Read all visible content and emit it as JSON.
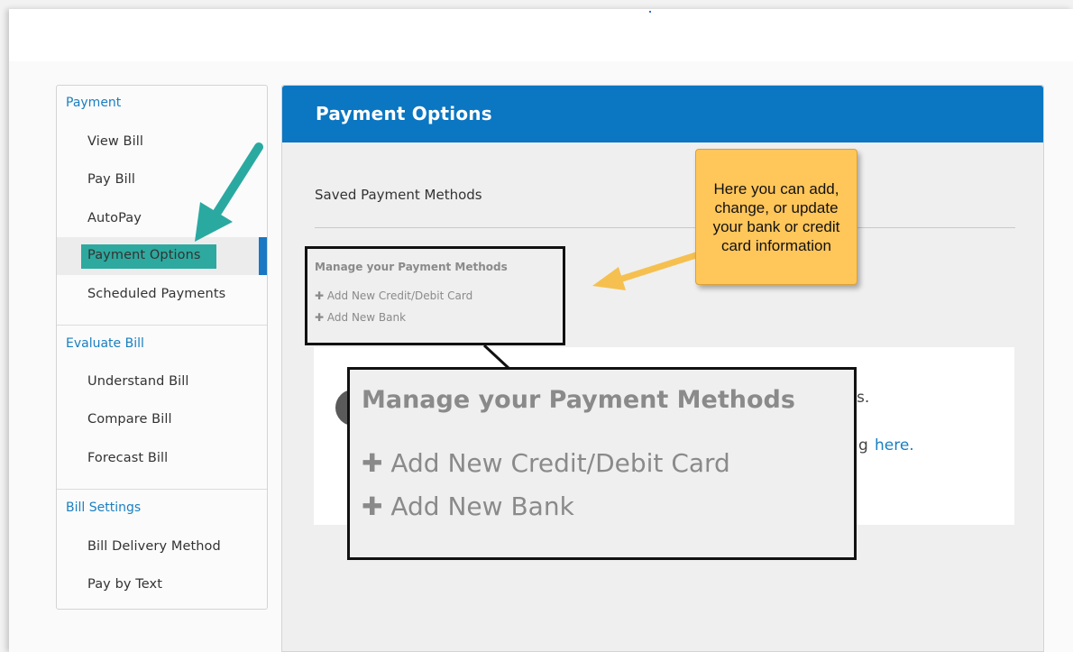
{
  "sidebar": {
    "groups": [
      {
        "label": "Payment",
        "items": [
          "View Bill",
          "Pay Bill",
          "AutoPay",
          "Payment Options",
          "Scheduled Payments"
        ]
      },
      {
        "label": "Evaluate Bill",
        "items": [
          "Understand Bill",
          "Compare Bill",
          "Forecast Bill"
        ]
      },
      {
        "label": "Bill Settings",
        "items": [
          "Bill Delivery Method",
          "Pay by Text"
        ]
      }
    ],
    "active_item": "Payment Options"
  },
  "main": {
    "title": "Payment Options",
    "saved_methods_label": "Saved Payment Methods",
    "manage": {
      "title": "Manage your Payment Methods",
      "add_card": "Add New Credit/Debit Card",
      "add_bank": "Add New Bank"
    },
    "partial_text_1": "s.",
    "partial_text_2": "g",
    "partial_link": "here."
  },
  "zoom_callout": {
    "title": "Manage your Payment Methods",
    "add_card": "Add New Credit/Debit Card",
    "add_bank": "Add New Bank"
  },
  "annotation": {
    "text": "Here you can add, change, or update your bank or credit card information"
  },
  "icons": {
    "plus": "plus-icon",
    "arrow": "arrow-icon"
  },
  "colors": {
    "accent_blue": "#0b76c1",
    "link_blue": "#1a7fc1",
    "highlight_teal": "#2ea99f",
    "tooltip_yellow": "#ffc65a",
    "arrow_teal": "#2aa9a1",
    "arrow_yellow": "#f5c04f"
  }
}
